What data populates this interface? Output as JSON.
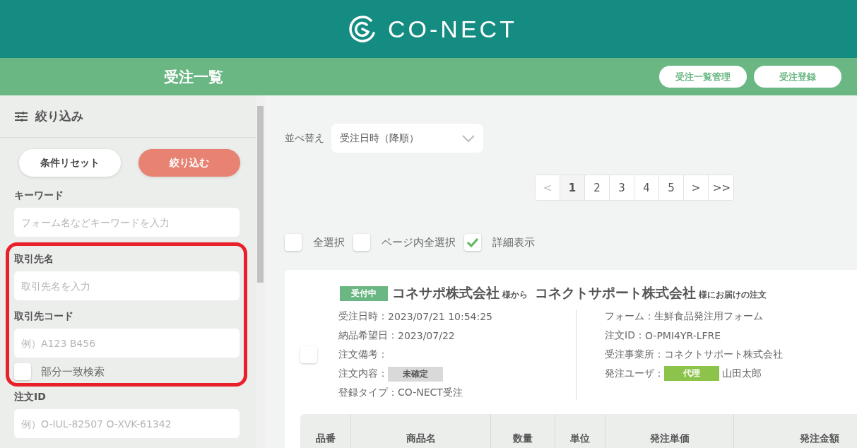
{
  "header": {
    "logo_text": "CO-NECT"
  },
  "subheader": {
    "title": "受注一覧",
    "buttons": [
      "受注一覧管理",
      "受注登録"
    ]
  },
  "sidebar": {
    "title": "絞り込み",
    "reset_button": "条件リセット",
    "apply_button": "絞り込む",
    "filters": [
      {
        "kind": "field",
        "label": "キーワード",
        "placeholder": "フォーム名などキーワードを入力"
      },
      {
        "kind": "group",
        "highlighted": true,
        "items": [
          {
            "kind": "field",
            "label": "取引先名",
            "placeholder": "取引先名を入力"
          },
          {
            "kind": "field",
            "label": "取引先コード",
            "placeholder": "例）A123 B456"
          },
          {
            "kind": "checkbox",
            "label": "部分一致検索",
            "checked": false
          }
        ]
      },
      {
        "kind": "field",
        "label": "注文ID",
        "placeholder": "例）O-IUL-82507 O-XVK-61342"
      }
    ]
  },
  "sort": {
    "label": "並べ替え",
    "value": "受注日時（降順）"
  },
  "pagination": [
    {
      "label": "<",
      "selected": false,
      "disabled": true
    },
    {
      "label": "1",
      "selected": true,
      "disabled": false
    },
    {
      "label": "2",
      "selected": false,
      "disabled": false
    },
    {
      "label": "3",
      "selected": false,
      "disabled": false
    },
    {
      "label": "4",
      "selected": false,
      "disabled": false
    },
    {
      "label": "5",
      "selected": false,
      "disabled": false
    },
    {
      "label": ">",
      "selected": false,
      "disabled": false
    },
    {
      "label": ">>",
      "selected": false,
      "disabled": false
    }
  ],
  "bulk_options": [
    {
      "label": "全選択",
      "checked": false
    },
    {
      "label": "ページ内全選択",
      "checked": false
    },
    {
      "label": "詳細表示",
      "checked": true
    }
  ],
  "order": {
    "checked": false,
    "status": "受付中",
    "from": "コネサポ株式会社",
    "from_suffix": "様から",
    "to": "コネクトサポート株式会社",
    "to_suffix": "様にお届けの注文",
    "left": [
      {
        "label": "受注日時：",
        "value": "2023/07/21 10:54:25"
      },
      {
        "label": "納品希望日：",
        "value": "2023/07/22"
      },
      {
        "label": "注文備考："
      },
      {
        "label": "注文内容：",
        "badge": {
          "text": "未確定",
          "color": "#d9d9d9"
        }
      },
      {
        "label": "登録タイプ：",
        "value": "CO-NECT受注"
      }
    ],
    "right": [
      {
        "label": "フォーム：",
        "value": "生鮮食品発注用フォーム"
      },
      {
        "label": "注文ID：",
        "value": "O-PMI4YR-LFRE"
      },
      {
        "label": "受注事業所：",
        "value": "コネクトサポート株式会社"
      },
      {
        "label": "発注ユーザ：",
        "badge": {
          "text": "代理",
          "color": "#8cc34a"
        },
        "value": "山田太郎"
      }
    ],
    "table_columns": [
      "品番",
      "商品名",
      "数量",
      "単位",
      "発注単価",
      "発注金額"
    ]
  }
}
